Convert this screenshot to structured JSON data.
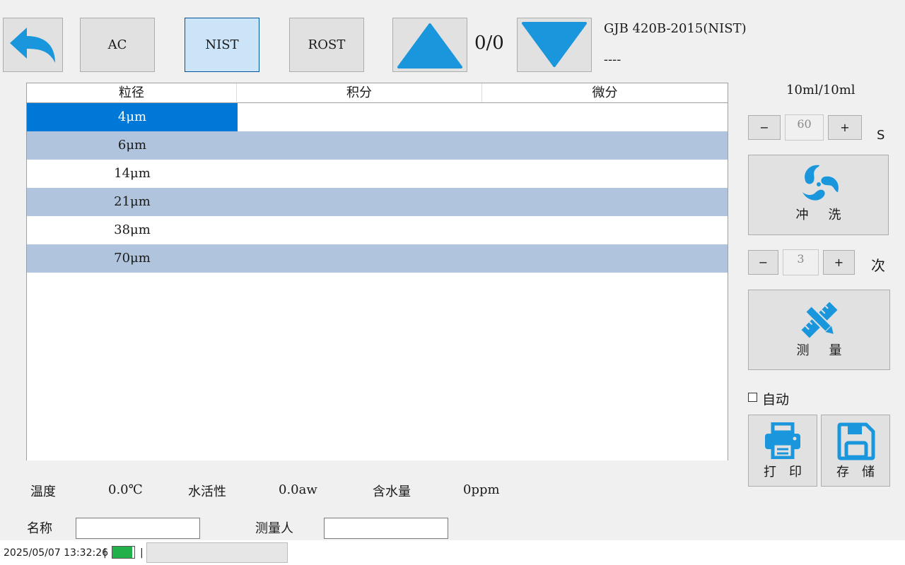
{
  "toolbar": {
    "back_label": "",
    "ac_label": "AC",
    "nist_label": "NIST",
    "rost_label": "ROST",
    "page_counter": "0/0",
    "standard_title": "GJB 420B-2015(NIST)",
    "standard_sub": "----"
  },
  "table": {
    "headers": [
      "粒径",
      "积分",
      "微分"
    ],
    "rows": [
      {
        "size": "4μm",
        "integral": "",
        "differential": ""
      },
      {
        "size": "6μm",
        "integral": "",
        "differential": ""
      },
      {
        "size": "14μm",
        "integral": "",
        "differential": ""
      },
      {
        "size": "21μm",
        "integral": "",
        "differential": ""
      },
      {
        "size": "38μm",
        "integral": "",
        "differential": ""
      },
      {
        "size": "70μm",
        "integral": "",
        "differential": ""
      }
    ]
  },
  "side": {
    "volume": "10ml/10ml",
    "time_minus": "−",
    "time_value": "60",
    "time_plus": "+",
    "time_unit": "S",
    "flush_label": "冲洗",
    "count_minus": "−",
    "count_value": "3",
    "count_plus": "+",
    "count_unit": "次",
    "measure_label": "测量",
    "auto_label": "自动",
    "print_label": "打印",
    "save_label": "存储"
  },
  "readings": {
    "temp_label": "温度",
    "temp_value": "0.0℃",
    "aw_label": "水活性",
    "aw_value": "0.0aw",
    "water_label": "含水量",
    "water_value": "0ppm"
  },
  "form": {
    "name_label": "名称",
    "name_value": "",
    "operator_label": "测量人",
    "operator_value": ""
  },
  "status": {
    "datetime": "2025/05/07 13:32:26",
    "sep1": "|",
    "battery_fill": 0.9,
    "sep2": "|"
  },
  "colors": {
    "accent": "#1a96dc",
    "selection": "#0078d7",
    "row_alt": "#b0c4de",
    "battery": "#22b04a"
  }
}
